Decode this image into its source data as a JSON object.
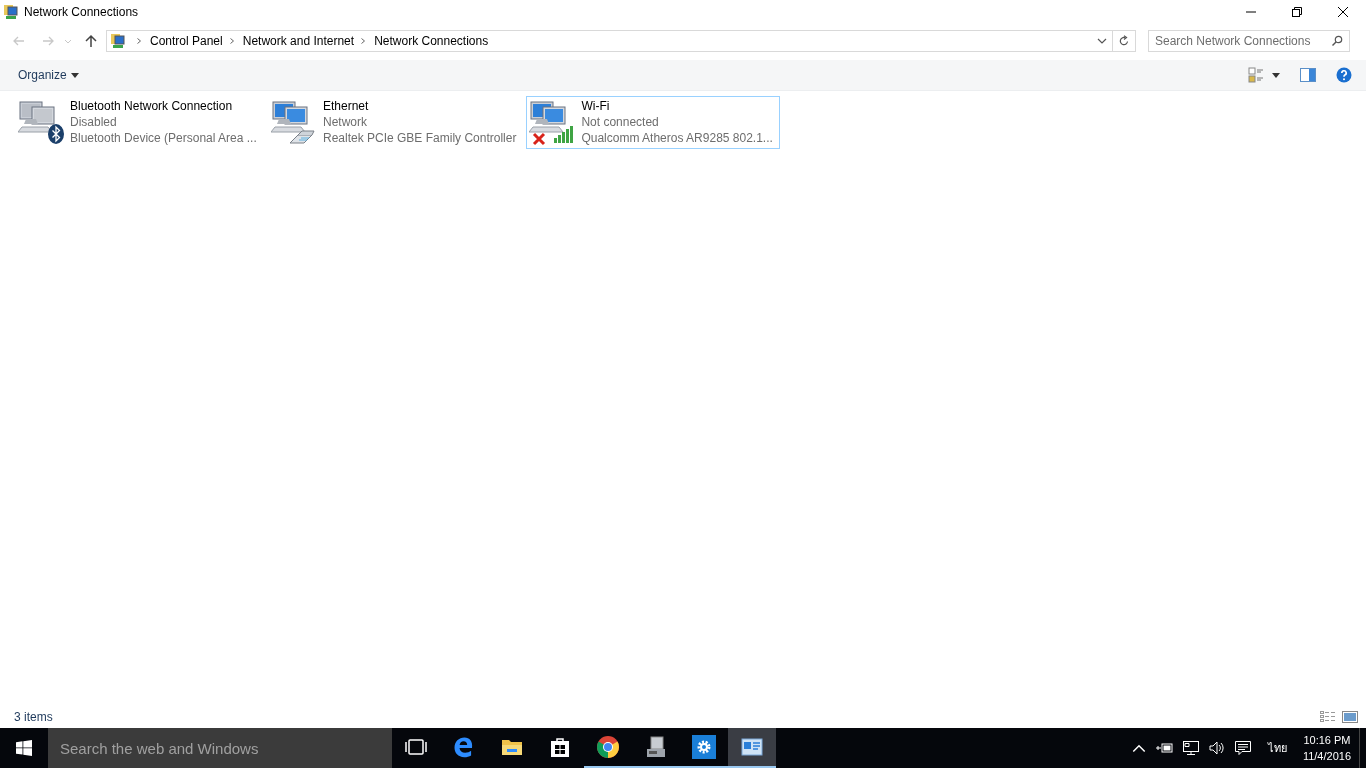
{
  "window": {
    "title": "Network Connections"
  },
  "address": {
    "path": [
      "Control Panel",
      "Network and Internet",
      "Network Connections"
    ]
  },
  "search": {
    "placeholder": "Search Network Connections"
  },
  "toolbar": {
    "organize": "Organize"
  },
  "connections": [
    {
      "kind": "bluetooth",
      "name": "Bluetooth Network Connection",
      "status": "Disabled",
      "device": "Bluetooth Device (Personal Area ...",
      "selected": false
    },
    {
      "kind": "ethernet",
      "name": "Ethernet",
      "status": "Network",
      "device": "Realtek PCIe GBE Family Controller",
      "selected": false
    },
    {
      "kind": "wifi",
      "name": "Wi-Fi",
      "status": "Not connected",
      "device": "Qualcomm Atheros AR9285 802.1...",
      "selected": true
    }
  ],
  "status_bar": {
    "items": "3 items"
  },
  "taskbar": {
    "search_placeholder": "Search the web and Windows",
    "apps": [
      {
        "kind": "taskview",
        "running": false,
        "active": false
      },
      {
        "kind": "edge",
        "running": false,
        "active": false
      },
      {
        "kind": "explorer",
        "running": false,
        "active": false
      },
      {
        "kind": "store",
        "running": false,
        "active": false
      },
      {
        "kind": "chrome",
        "running": true,
        "active": false
      },
      {
        "kind": "server",
        "running": true,
        "active": false
      },
      {
        "kind": "settings",
        "running": true,
        "active": false
      },
      {
        "kind": "network",
        "running": true,
        "active": true
      }
    ],
    "language": "ไทย",
    "time": "10:16 PM",
    "date": "11/4/2016"
  }
}
